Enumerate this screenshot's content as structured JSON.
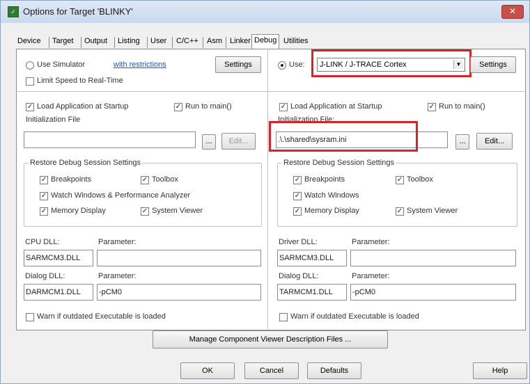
{
  "window": {
    "title": "Options for Target 'BLINKY'",
    "close_glyph": "✕"
  },
  "tabs": [
    "Device",
    "Target",
    "Output",
    "Listing",
    "User",
    "C/C++",
    "Asm",
    "Linker",
    "Debug",
    "Utilities"
  ],
  "active_tab": "Debug",
  "left": {
    "use_simulator": "Use Simulator",
    "with_restrictions": "with restrictions",
    "settings": "Settings",
    "limit_speed": "Limit Speed to Real-Time",
    "load_app": "Load Application at Startup",
    "run_to_main": "Run to main()",
    "init_file_label": "Initialization File",
    "init_file_value": "",
    "browse": "...",
    "edit": "Edit...",
    "restore_title": "Restore Debug Session Settings",
    "breakpoints": "Breakpoints",
    "toolbox": "Toolbox",
    "watch": "Watch Windows & Performance Analyzer",
    "memory": "Memory Display",
    "sysviewer": "System Viewer",
    "dll_label": "CPU DLL:",
    "param_label": "Parameter:",
    "dll_value": "SARMCM3.DLL",
    "param_value": "",
    "dialog_label": "Dialog DLL:",
    "dialog_param_label": "Parameter:",
    "dialog_value": "DARMCM1.DLL",
    "dialog_param_value": "-pCM0",
    "warn": "Warn if outdated Executable is loaded"
  },
  "right": {
    "use": "Use:",
    "debugger": "J-LINK / J-TRACE Cortex",
    "settings": "Settings",
    "load_app": "Load Application at Startup",
    "run_to_main": "Run to main()",
    "init_file_label": "Initialization File:",
    "init_file_value": ".\\.\\shared\\sysram.ini",
    "browse": "...",
    "edit": "Edit...",
    "restore_title": "Restore Debug Session Settings",
    "breakpoints": "Breakpoints",
    "toolbox": "Toolbox",
    "watch": "Watch Windows",
    "memory": "Memory Display",
    "sysviewer": "System Viewer",
    "dll_label": "Driver DLL:",
    "param_label": "Parameter:",
    "dll_value": "SARMCM3.DLL",
    "param_value": "",
    "dialog_label": "Dialog DLL:",
    "dialog_param_label": "Parameter:",
    "dialog_value": "TARMCM1.DLL",
    "dialog_param_value": "-pCM0",
    "warn": "Warn if outdated Executable is loaded"
  },
  "manage_button": "Manage Component Viewer Description Files ...",
  "buttons": {
    "ok": "OK",
    "cancel": "Cancel",
    "defaults": "Defaults",
    "help": "Help"
  },
  "check_glyph": "✓",
  "highlight_color": "#d9222a"
}
